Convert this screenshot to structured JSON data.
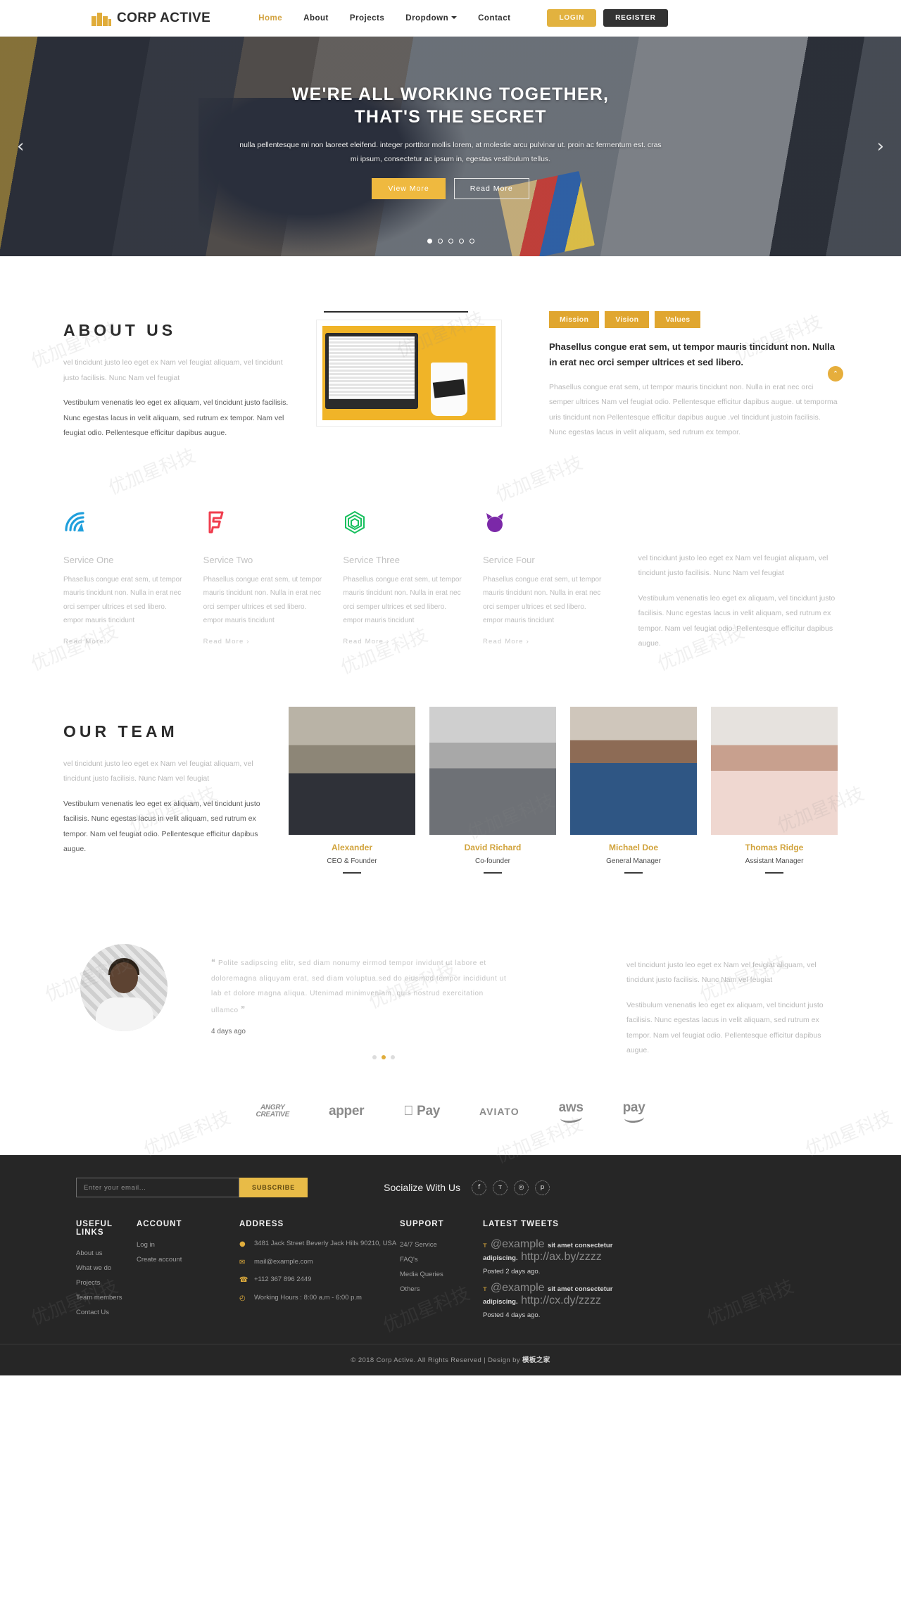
{
  "nav": {
    "brand": "CORP ACTIVE",
    "links": [
      {
        "label": "Home",
        "active": true
      },
      {
        "label": "About",
        "active": false
      },
      {
        "label": "Projects",
        "active": false
      },
      {
        "label": "Dropdown",
        "active": false,
        "caret": true
      },
      {
        "label": "Contact",
        "active": false
      }
    ],
    "login": "LOGIN",
    "register": "REGISTER"
  },
  "hero": {
    "title_line1": "WE'RE ALL WORKING TOGETHER,",
    "title_line2": "THAT'S THE SECRET",
    "subtitle": "nulla pellentesque mi non laoreet eleifend. integer porttitor mollis lorem, at molestie arcu pulvinar ut. proin ac fermentum est. cras mi ipsum, consectetur ac ipsum in, egestas vestibulum tellus.",
    "btn_primary": "View More",
    "btn_secondary": "Read More",
    "arrow_left": "‹",
    "arrow_right": "›",
    "dots": 5,
    "active_dot": 0,
    "accent": "#efb93f"
  },
  "about": {
    "title": "ABOUT US",
    "p1": "vel tincidunt justo leo eget ex Nam vel feugiat aliquam, vel tincidunt justo facilisis. Nunc Nam vel feugiat",
    "p2": "Vestibulum venenatis leo eget ex aliquam, vel tincidunt justo facilisis. Nunc egestas lacus in velit aliquam, sed rutrum ex tempor. Nam vel feugiat odio. Pellentesque efficitur dapibus augue.",
    "tabs": [
      "Mission",
      "Vision",
      "Values"
    ],
    "lead": "Phasellus congue erat sem, ut tempor mauris tincidunt non. Nulla in erat nec orci semper ultrices et sed libero.",
    "detail": "Phasellus congue erat sem, ut tempor mauris tincidunt non. Nulla in erat nec orci semper ultrices Nam vel feugiat odio. Pellentesque efficitur dapibus augue. ut temporma uris tincidunt non Pellentesque efficitur dapibus augue .vel tincidunt justoin facilisis. Nunc egestas lacus in velit aliquam, sed rutrum ex tempor.",
    "tab_color": "#e0a62f",
    "scroll_top_icon": "⌃"
  },
  "services": {
    "items": [
      {
        "icon": "signal-wave-icon",
        "icon_color": "#1f9fdc",
        "title": "Service One",
        "text": "Phasellus congue erat sem, ut tempor mauris tincidunt non. Nulla in erat nec orci semper ultrices et sed libero. empor mauris tincidunt",
        "link": "Read More ›"
      },
      {
        "icon": "foursquare-flag-icon",
        "icon_color": "#f03d4e",
        "title": "Service Two",
        "text": "Phasellus congue erat sem, ut tempor mauris tincidunt non. Nulla in erat nec orci semper ultrices et sed libero. empor mauris tincidunt",
        "link": "Read More ›"
      },
      {
        "icon": "hexagon-burst-icon",
        "icon_color": "#17c05e",
        "title": "Service Three",
        "text": "Phasellus congue erat sem, ut tempor mauris tincidunt non. Nulla in erat nec orci semper ultrices et sed libero. empor mauris tincidunt",
        "link": "Read More ›"
      },
      {
        "icon": "cat-face-icon",
        "icon_color": "#7b28a8",
        "title": "Service Four",
        "text": "Phasellus congue erat sem, ut tempor mauris tincidunt non. Nulla in erat nec orci semper ultrices et sed libero. empor mauris tincidunt",
        "link": "Read More ›"
      }
    ],
    "side_p1": "vel tincidunt justo leo eget ex Nam vel feugiat aliquam, vel tincidunt justo facilisis. Nunc Nam vel feugiat",
    "side_p2": "Vestibulum venenatis leo eget ex aliquam, vel tincidunt justo facilisis. Nunc egestas lacus in velit aliquam, sed rutrum ex tempor. Nam vel feugiat odio. Pellentesque efficitur dapibus augue."
  },
  "team": {
    "title": "OUR TEAM",
    "p1": "vel tincidunt justo leo eget ex Nam vel feugiat aliquam, vel tincidunt justo facilisis. Nunc Nam vel feugiat",
    "p2": "Vestibulum venenatis leo eget ex aliquam, vel tincidunt justo facilisis. Nunc egestas lacus in velit aliquam, sed rutrum ex tempor. Nam vel feugiat odio. Pellentesque efficitur dapibus augue.",
    "members": [
      {
        "name": "Alexander",
        "role": "CEO & Founder"
      },
      {
        "name": "David Richard",
        "role": "Co-founder"
      },
      {
        "name": "Michael Doe",
        "role": "General Manager"
      },
      {
        "name": "Thomas Ridge",
        "role": "Assistant Manager"
      }
    ],
    "name_color": "#d1a33c"
  },
  "testimonial": {
    "quote_open": "“",
    "quote_close": "”",
    "quote": "Polite sadipscing elitr, sed diam nonumy eirmod tempor invidunt ut labore et doloremagna aliquyam erat, sed diam voluptua.sed do eiusmod tempor incididunt ut lab et dolore magna aliqua. Utenimad minimveniam, quis nostrud exercitation ullamco",
    "time": "4 days ago",
    "side_p1": "vel tincidunt justo leo eget ex Nam vel feugiat aliquam, vel tincidunt justo facilisis. Nunc Nam vel feugiat",
    "side_p2": "Vestibulum venenatis leo eget ex aliquam, vel tincidunt justo facilisis. Nunc egestas lacus in velit aliquam, sed rutrum ex tempor. Nam vel feugiat odio. Pellentesque efficitur dapibus augue.",
    "dots": 3,
    "active_dot": 1
  },
  "brands": [
    {
      "name": "angry-creative-logo",
      "line1": "ANGRY",
      "line2": "CREATIVE"
    },
    {
      "name": "apper-logo",
      "text": "apper"
    },
    {
      "name": "apple-pay-logo",
      "text": " Pay"
    },
    {
      "name": "aviato-logo",
      "text": "AVIATO"
    },
    {
      "name": "aws-logo",
      "text": "aws"
    },
    {
      "name": "amazon-pay-logo",
      "text": "pay"
    }
  ],
  "footer": {
    "newsletter_placeholder": "Enter your email...",
    "newsletter_value": "",
    "subscribe": "SUBSCRIBE",
    "social_label": "Socialize With Us",
    "socials": [
      {
        "name": "facebook-icon",
        "glyph": "f"
      },
      {
        "name": "twitter-icon",
        "glyph": "ᴛ"
      },
      {
        "name": "instagram-icon",
        "glyph": "◎"
      },
      {
        "name": "pinterest-icon",
        "glyph": "p"
      }
    ],
    "useful_links": {
      "title": "USEFUL LINKS",
      "items": [
        "About us",
        "What we do",
        "Projects",
        "Team members",
        "Contact Us"
      ]
    },
    "account": {
      "title": "ACCOUNT",
      "items": [
        "Log in",
        "Create account"
      ]
    },
    "address": {
      "title": "ADDRESS",
      "rows": [
        {
          "icon": "location-pin-icon",
          "glyph": "●",
          "text": "3481 Jack Street Beverly Jack Hills 90210, USA"
        },
        {
          "icon": "envelope-icon",
          "glyph": "✉",
          "text": "mail@example.com"
        },
        {
          "icon": "phone-icon",
          "glyph": "☎",
          "text": "+112 367 896 2449"
        },
        {
          "icon": "clock-icon",
          "glyph": "◴",
          "text": "Working Hours : 8:00 a.m - 6:00 p.m"
        }
      ]
    },
    "support": {
      "title": "SUPPORT",
      "items": [
        "24/7 Service",
        "FAQ's",
        "Media Queries",
        "Others"
      ]
    },
    "tweets": {
      "title": "LATEST TWEETS",
      "items": [
        {
          "handle": "@example",
          "body": "sit amet consectetur adipiscing.",
          "link": "http://ax.by/zzzz",
          "meta": "Posted 2 days ago."
        },
        {
          "handle": "@example",
          "body": "sit amet consectetur adipiscing.",
          "link": "http://cx.dy/zzzz",
          "meta": "Posted 4 days ago."
        }
      ]
    },
    "copyright_pre": "© 2018 Corp Active. All Rights Reserved | Design by ",
    "copyright_brand": "模板之家"
  },
  "watermark": "优加星科技"
}
